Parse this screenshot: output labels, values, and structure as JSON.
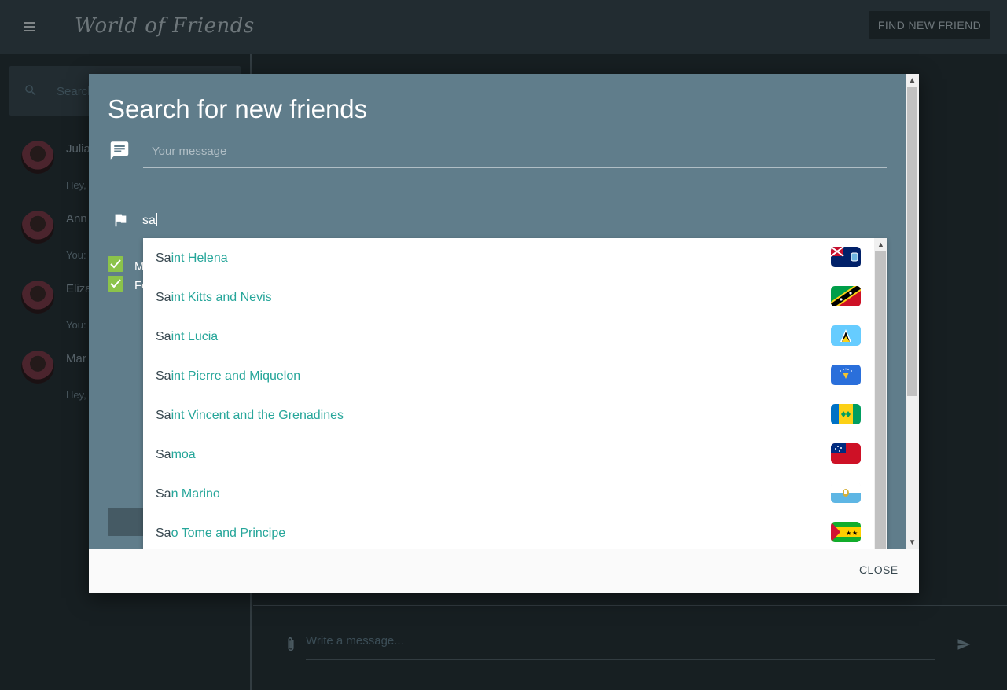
{
  "app": {
    "title": "World of Friends",
    "find_button": "FIND NEW FRIEND"
  },
  "sidebar": {
    "search_placeholder": "Search",
    "conversations": [
      {
        "name": "Julia",
        "preview": "Hey,"
      },
      {
        "name": "Ann",
        "preview": "You:"
      },
      {
        "name": "Eliza",
        "preview": "You:"
      },
      {
        "name": "Mar",
        "preview": "Hey,"
      }
    ]
  },
  "chat": {
    "message_placeholder": "Write a message..."
  },
  "dialog": {
    "title": "Search for new friends",
    "message_placeholder": "Your message",
    "country_value": "sa",
    "checkboxes": [
      {
        "label": "M",
        "checked": true
      },
      {
        "label": "Fe",
        "checked": true
      }
    ],
    "close_label": "CLOSE",
    "suggestions": [
      {
        "match": "Sa",
        "rest": "int Helena",
        "flag": "saint-helena-flag"
      },
      {
        "match": "Sa",
        "rest": "int Kitts and Nevis",
        "flag": "saint-kitts-flag"
      },
      {
        "match": "Sa",
        "rest": "int Lucia",
        "flag": "saint-lucia-flag"
      },
      {
        "match": "Sa",
        "rest": "int Pierre and Miquelon",
        "flag": "saint-pierre-flag"
      },
      {
        "match": "Sa",
        "rest": "int Vincent and the Grenadines",
        "flag": "saint-vincent-flag"
      },
      {
        "match": "Sa",
        "rest": "moa",
        "flag": "samoa-flag"
      },
      {
        "match": "Sa",
        "rest": "n Marino",
        "flag": "san-marino-flag"
      },
      {
        "match": "Sa",
        "rest": "o Tome and Principe",
        "flag": "sao-tome-flag"
      }
    ]
  },
  "colors": {
    "app_bar": "#37474f",
    "background": "#263238",
    "dialog_body": "#607d8b",
    "accent": "#26a69a",
    "checkbox": "#8bc34a"
  }
}
